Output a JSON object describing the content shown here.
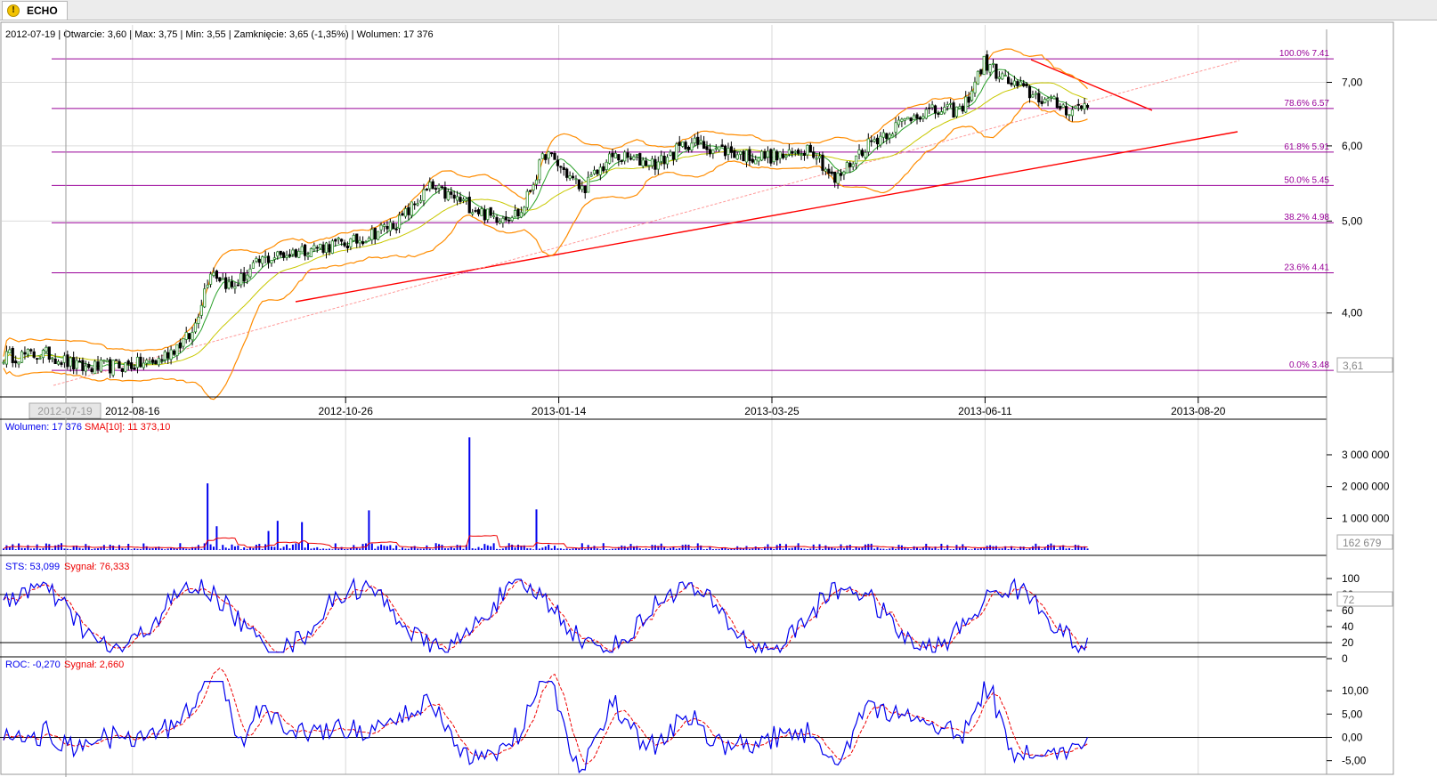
{
  "tab": {
    "title": "ECHO",
    "icon": "warning-icon"
  },
  "info_line": "2012-07-19 | Otwarcie: 3,60 | Max: 3,75 | Min: 3,55 | Zamknięcie: 3,65 (-1,35%)   | Wolumen: 17 376",
  "colors": {
    "up": "#2a8a2a",
    "down": "#000000",
    "bollinger": "#ff8c00",
    "ma_fast": "#2aa02a",
    "ma_slow": "#c8c800",
    "trend": "#ff0000",
    "fib": "#990099",
    "volume": "#0000ee",
    "sma": "#ee0000",
    "indicator": "#0000ee",
    "signal": "#ee0000"
  },
  "price_panel": {
    "current_price_label": "3,61",
    "hover_date_label": "2012-07-19",
    "x_ticks": [
      "2012-08-16",
      "2012-10-26",
      "2013-01-14",
      "2013-03-25",
      "2013-06-11",
      "2013-08-20"
    ],
    "y_ticks": [
      "4,00",
      "5,00",
      "6,00",
      "7,00"
    ],
    "fib_levels": [
      {
        "label": "100.0% 7.41",
        "value": 7.41
      },
      {
        "label": "78.6% 6.57",
        "value": 6.57
      },
      {
        "label": "61.8% 5.91",
        "value": 5.91
      },
      {
        "label": "50.0% 5.45",
        "value": 5.45
      },
      {
        "label": "38.2% 4.98",
        "value": 4.98
      },
      {
        "label": "23.6% 4.41",
        "value": 4.41
      },
      {
        "label": "0.0% 3.48",
        "value": 3.48
      }
    ]
  },
  "volume_panel": {
    "legend_name": "Wolumen: 17 376",
    "legend_sma": "SMA[10]: 11 373,10",
    "current_label": "162 679",
    "y_ticks": [
      "1 000 000",
      "2 000 000",
      "3 000 000"
    ]
  },
  "sts_panel": {
    "legend_name": "STS: 53,099",
    "legend_signal": "Sygnał: 76,333",
    "current_label": "72",
    "y_ticks": [
      "0",
      "20",
      "40",
      "60",
      "80",
      "100"
    ]
  },
  "roc_panel": {
    "legend_name": "ROC: -0,270",
    "legend_signal": "Sygnał: 2,660",
    "y_ticks": [
      "-5,00",
      "0,00",
      "5,00",
      "10,00"
    ]
  },
  "chart_data": {
    "type": "candlestick",
    "series_anchor_close": [
      [
        0,
        3.6
      ],
      [
        15,
        3.62
      ],
      [
        25,
        3.5
      ],
      [
        40,
        3.52
      ],
      [
        50,
        3.55
      ],
      [
        62,
        3.8
      ],
      [
        68,
        4.45
      ],
      [
        75,
        4.25
      ],
      [
        85,
        4.55
      ],
      [
        100,
        4.68
      ],
      [
        115,
        4.75
      ],
      [
        130,
        5.0
      ],
      [
        140,
        5.42
      ],
      [
        150,
        5.25
      ],
      [
        160,
        5.05
      ],
      [
        170,
        5.1
      ],
      [
        178,
        5.9
      ],
      [
        190,
        5.4
      ],
      [
        200,
        5.85
      ],
      [
        215,
        5.75
      ],
      [
        225,
        6.05
      ],
      [
        235,
        5.95
      ],
      [
        245,
        5.85
      ],
      [
        258,
        5.85
      ],
      [
        265,
        6.0
      ],
      [
        273,
        5.5
      ],
      [
        283,
        6.0
      ],
      [
        300,
        6.5
      ],
      [
        315,
        6.55
      ],
      [
        322,
        7.35
      ],
      [
        330,
        7.0
      ],
      [
        340,
        6.75
      ],
      [
        350,
        6.55
      ],
      [
        355,
        6.62
      ]
    ],
    "date_ticks": [
      "2012-08-16",
      "2012-10-26",
      "2013-01-14",
      "2013-03-25",
      "2013-06-11",
      "2013-08-20"
    ],
    "fibonacci": {
      "high": 7.41,
      "low": 3.48,
      "levels": [
        [
          1.0,
          7.41
        ],
        [
          0.786,
          6.57
        ],
        [
          0.618,
          5.91
        ],
        [
          0.5,
          5.45
        ],
        [
          0.382,
          4.98
        ],
        [
          0.236,
          4.41
        ],
        [
          0.0,
          3.48
        ]
      ]
    },
    "volume_spikes": [
      [
        153,
        3550000
      ],
      [
        67,
        2100000
      ],
      [
        120,
        1250000
      ],
      [
        175,
        1280000
      ],
      [
        90,
        920000
      ],
      [
        98,
        880000
      ],
      [
        87,
        600000
      ],
      [
        70,
        750000
      ]
    ],
    "volume_axis": [
      0,
      3000000
    ],
    "sts_axis": [
      0,
      100
    ],
    "sts_bands": [
      20,
      80
    ],
    "roc_axis": [
      -5,
      10
    ]
  }
}
